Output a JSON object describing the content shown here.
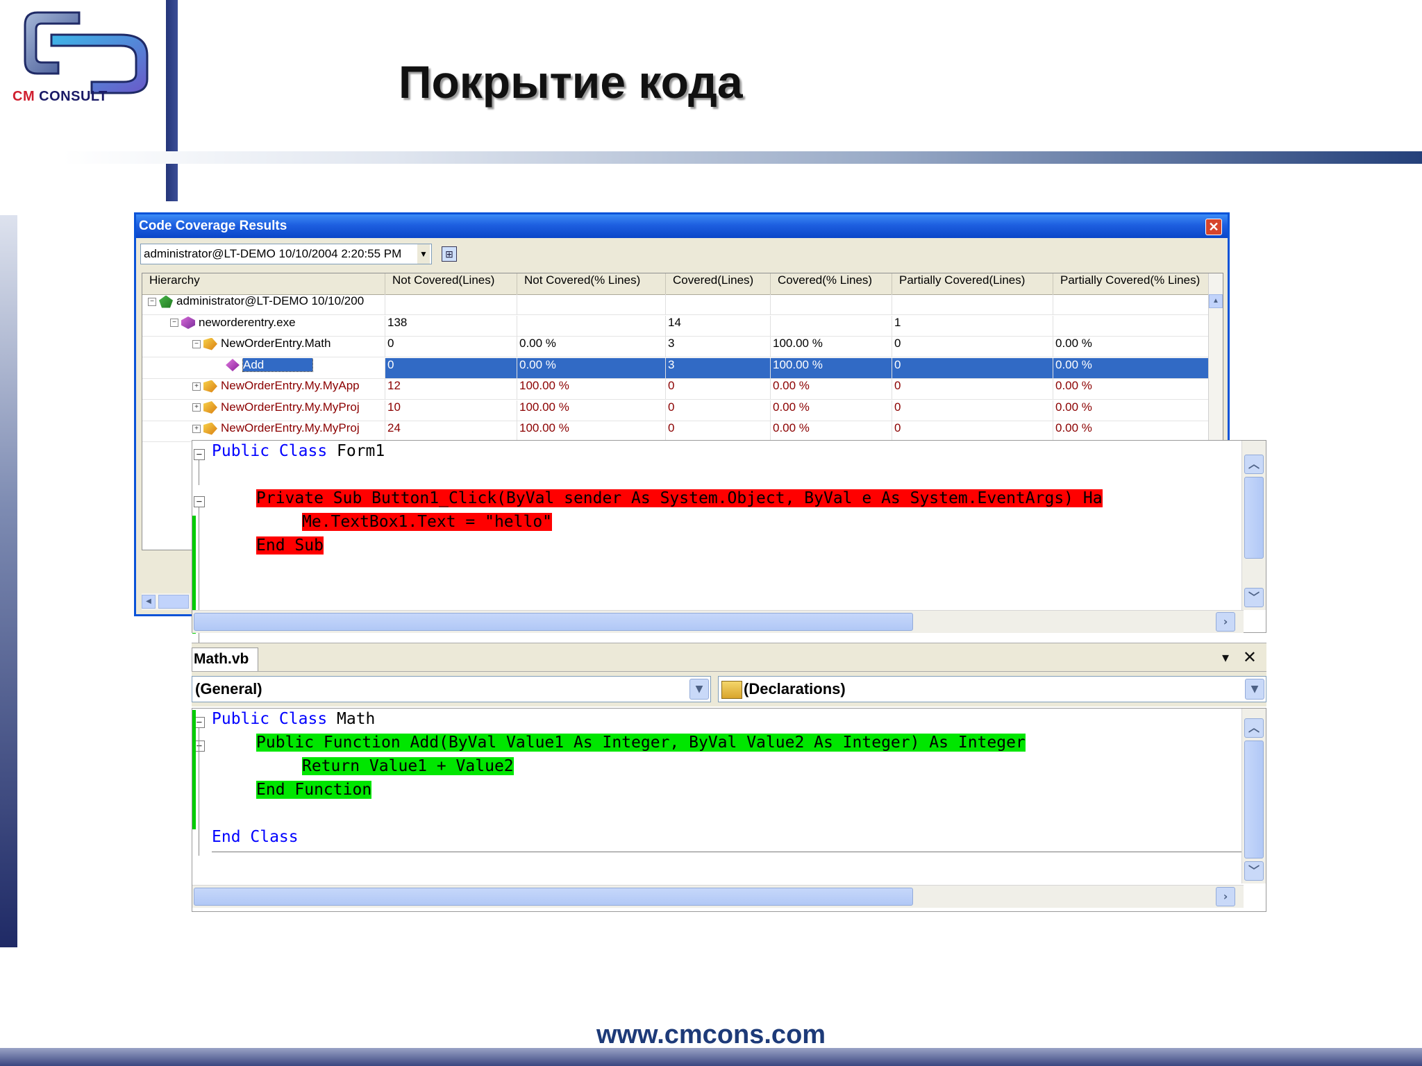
{
  "slide": {
    "title": "Покрытие кода",
    "logo_text_cm": "CM",
    "logo_text_consult": "CONSULT",
    "footer_url": "www.cmcons.com"
  },
  "coverage_window": {
    "title": "Code Coverage Results",
    "close_glyph": "✕",
    "run_selector": "administrator@LT-DEMO 10/10/2004 2:20:55 PM",
    "columns": [
      "Hierarchy",
      "Not Covered(Lines)",
      "Not Covered(% Lines)",
      "Covered(Lines)",
      "Covered(% Lines)",
      "Partially Covered(Lines)",
      "Partially Covered(% Lines)"
    ],
    "rows": [
      {
        "toggle": "−",
        "icon": "run-icon",
        "name": "administrator@LT-DEMO 10/10/200",
        "nc": "",
        "ncp": "",
        "c": "",
        "cp": "",
        "pc": "",
        "pcp": ""
      },
      {
        "toggle": "−",
        "icon": "assembly-icon",
        "name": "neworderentry.exe",
        "nc": "138",
        "ncp": "",
        "c": "14",
        "cp": "",
        "pc": "1",
        "pcp": ""
      },
      {
        "toggle": "−",
        "icon": "namespace-icon",
        "name": "NewOrderEntry.Math",
        "nc": "0",
        "ncp": "0.00 %",
        "c": "3",
        "cp": "100.00 %",
        "pc": "0",
        "pcp": "0.00 %"
      },
      {
        "toggle": "",
        "icon": "method-icon",
        "name": "Add",
        "nc": "0",
        "ncp": "0.00 %",
        "c": "3",
        "cp": "100.00 %",
        "pc": "0",
        "pcp": "0.00 %"
      },
      {
        "toggle": "+",
        "icon": "namespace-icon",
        "name": "NewOrderEntry.My.MyApp",
        "nc": "12",
        "ncp": "100.00 %",
        "c": "0",
        "cp": "0.00 %",
        "pc": "0",
        "pcp": "0.00 %"
      },
      {
        "toggle": "+",
        "icon": "namespace-icon",
        "name": "NewOrderEntry.My.MyProj",
        "nc": "10",
        "ncp": "100.00 %",
        "c": "0",
        "cp": "0.00 %",
        "pc": "0",
        "pcp": "0.00 %"
      },
      {
        "toggle": "+",
        "icon": "namespace-icon",
        "name": "NewOrderEntry.My.MyProj",
        "nc": "24",
        "ncp": "100.00 %",
        "c": "0",
        "cp": "0.00 %",
        "pc": "0",
        "pcp": "0.00 %"
      }
    ],
    "selected_row": 3
  },
  "form1_editor": {
    "line1_kw": "Public Class",
    "line1_name": " Form1",
    "line2": "Private Sub Button1_Click(ByVal sender As System.Object, ByVal e As System.EventArgs) Ha",
    "line3": "Me.TextBox1.Text = \"hello\"",
    "line4": "End Sub",
    "highlight_color": "#ff0000"
  },
  "math_editor": {
    "tab_label": "Math.vb",
    "pin_glyph": "▾",
    "close_glyph": "✕",
    "general_select": "(General)",
    "declarations_select": "(Declarations)",
    "line1_kw": "Public Class",
    "line1_name": " Math",
    "line2": "Public Function Add(ByVal Value1 As Integer, ByVal Value2 As Integer) As Integer",
    "line3": "Return Value1 + Value2",
    "line4": "End Function",
    "line5_kw": "End Class",
    "highlight_color": "#00e600"
  }
}
